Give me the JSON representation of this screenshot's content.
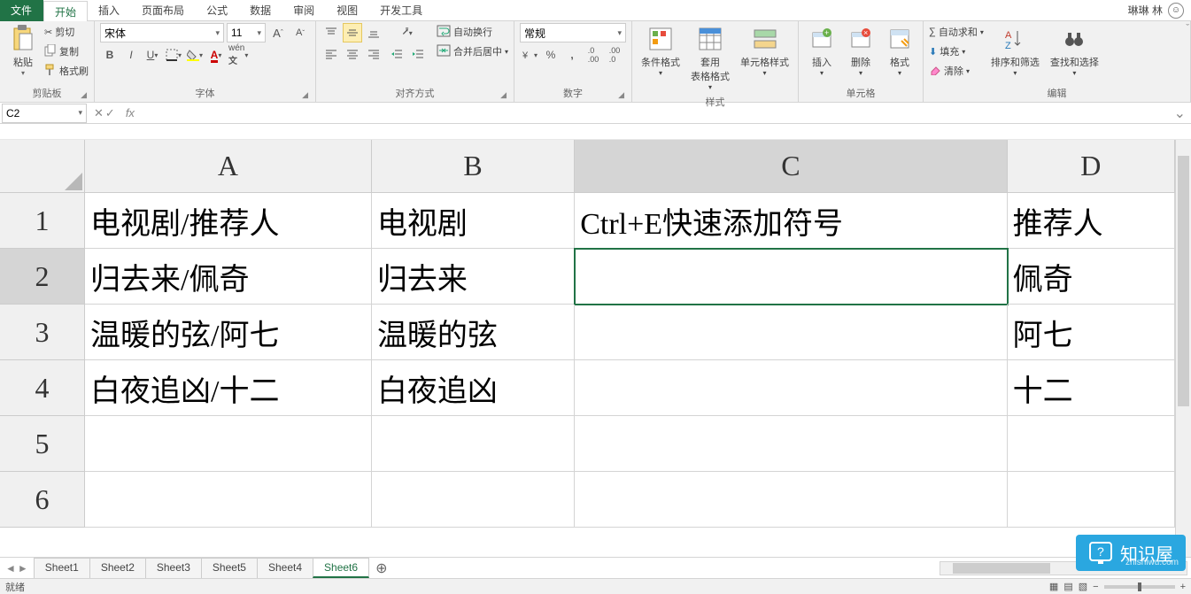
{
  "user": {
    "name": "琳琳 林"
  },
  "menu": {
    "file": "文件",
    "tabs": [
      "开始",
      "插入",
      "页面布局",
      "公式",
      "数据",
      "审阅",
      "视图",
      "开发工具"
    ],
    "active": 0
  },
  "ribbon": {
    "clipboard": {
      "paste": "粘贴",
      "cut": "剪切",
      "copy": "复制",
      "formatPainter": "格式刷",
      "label": "剪贴板"
    },
    "font": {
      "name": "宋体",
      "size": "11",
      "label": "字体"
    },
    "align": {
      "wrap": "自动换行",
      "merge": "合并后居中",
      "label": "对齐方式"
    },
    "number": {
      "fmt": "常规",
      "label": "数字"
    },
    "styles": {
      "cond": "条件格式",
      "table": "套用\n表格格式",
      "cell": "单元格样式",
      "label": "样式"
    },
    "cells": {
      "insert": "插入",
      "delete": "删除",
      "format": "格式",
      "label": "单元格"
    },
    "editing": {
      "sum": "自动求和",
      "fill": "填充",
      "clear": "清除",
      "sort": "排序和筛选",
      "find": "查找和选择",
      "label": "编辑"
    }
  },
  "namebox": "C2",
  "formula": "",
  "columns": [
    "A",
    "B",
    "C",
    "D"
  ],
  "colWidths": [
    "colA",
    "colB",
    "colC",
    "colD"
  ],
  "rows": [
    "1",
    "2",
    "3",
    "4",
    "5",
    "6"
  ],
  "activeCell": {
    "r": 1,
    "c": 2
  },
  "data": [
    [
      "电视剧/推荐人",
      "电视剧",
      "Ctrl+E快速添加符号",
      "推荐人"
    ],
    [
      "归去来/佩奇",
      "归去来",
      "",
      "佩奇"
    ],
    [
      "温暖的弦/阿七",
      "温暖的弦",
      "",
      "阿七"
    ],
    [
      "白夜追凶/十二",
      "白夜追凶",
      "",
      "十二"
    ],
    [
      "",
      "",
      "",
      ""
    ],
    [
      "",
      "",
      "",
      ""
    ]
  ],
  "sheets": {
    "list": [
      "Sheet1",
      "Sheet2",
      "Sheet3",
      "Sheet5",
      "Sheet4",
      "Sheet6"
    ],
    "active": 5
  },
  "status": {
    "ready": "就绪"
  },
  "watermark": {
    "text": "知识屋",
    "sub": "zhishiwu.com"
  }
}
